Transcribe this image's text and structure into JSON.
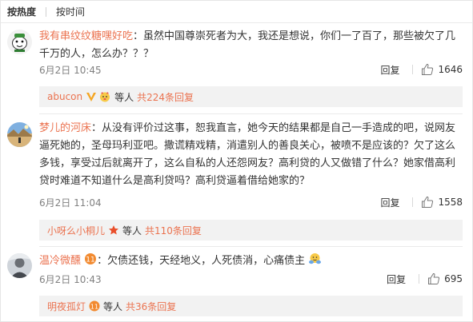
{
  "sort_bar": {
    "active": "按热度",
    "other": "按时间"
  },
  "comments": [
    {
      "username": "我有串纹纹糖嘿好吃",
      "text": "：虽然中国尊崇死者为大，我还是想说，你们一了百了，那些被欠了几千万的人，怎么办？？？",
      "time": "6月2日 10:45",
      "reply_label": "回复",
      "likes": "1646",
      "sub": {
        "name": "abucon",
        "etc": "等人",
        "count": "共224条回复"
      }
    },
    {
      "username": "梦儿的河床",
      "text": "：从没有评价过这事，恕我直言，她今天的结果都是自己一手造成的吧，说网友逼死她的，圣母玛利亚吧。撒谎精戏精，消遣别人的善良关心，被喷不是应该的？欠了这么多钱，享受过后就离开了，这么自私的人还怨网友？高利贷的人又做错了什么？她家借高利贷时难道不知道什么是高利贷吗？高利贷逼着借给她家的？",
      "time": "6月2日 11:04",
      "reply_label": "回复",
      "likes": "1558",
      "sub": {
        "name": "小呀么小桐儿",
        "etc": "等人",
        "count": "共110条回复"
      }
    },
    {
      "username": "温冷微醺",
      "text": "：欠债还钱，天经地义，人死债消，心痛债主",
      "time": "6月2日 10:43",
      "reply_label": "回复",
      "likes": "695",
      "sub": {
        "name": "明夜孤灯",
        "etc": "等人",
        "count": "共36条回复"
      }
    }
  ],
  "colors": {
    "username": "#eb7350",
    "subreply_bg": "#f2f2f2",
    "text": "#333333",
    "meta": "#808080"
  },
  "icons": [
    "thumbs-up-icon",
    "v-verified-icon",
    "emoji-face-icon",
    "level-badge-icon",
    "star-icon",
    "hug-emoji-icon"
  ]
}
